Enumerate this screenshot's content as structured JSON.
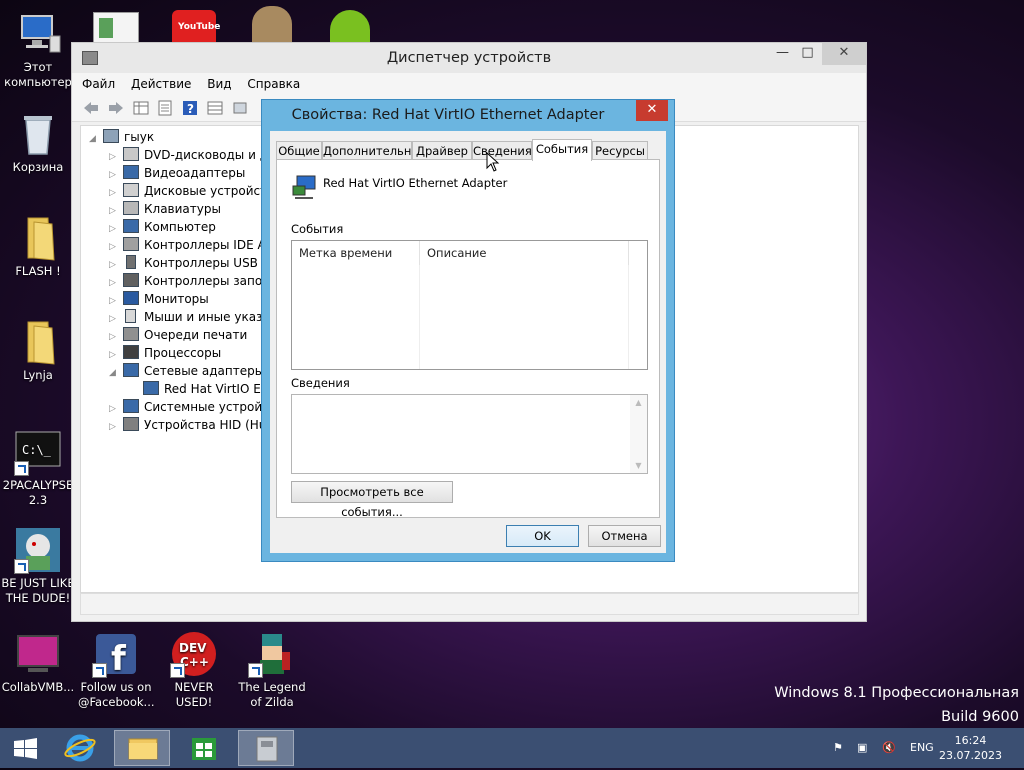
{
  "desktop_icons": [
    {
      "label": "Этот компьютер"
    },
    {
      "label": "Корзина"
    },
    {
      "label": "FLASH !"
    },
    {
      "label": "Lynja"
    },
    {
      "label": "2PACALYPSE 2.3"
    },
    {
      "label": "BE JUST LIKE THE DUDE!"
    },
    {
      "label": "CollabVMB..."
    },
    {
      "label": "Follow us on @Facebook..."
    },
    {
      "label": "NEVER USED!"
    },
    {
      "label": "The Legend of Zilda"
    }
  ],
  "device_manager": {
    "title": "Диспетчер устройств",
    "menu": [
      "Файл",
      "Действие",
      "Вид",
      "Справка"
    ],
    "tree": {
      "root": "гыук",
      "items": [
        "DVD-дисководы и дис",
        "Видеоадаптеры",
        "Дисковые устройства",
        "Клавиатуры",
        "Компьютер",
        "Контроллеры IDE ATA",
        "Контроллеры USB",
        "Контроллеры запоми",
        "Мониторы",
        "Мыши и иные указы",
        "Очереди печати",
        "Процессоры",
        "Сетевые адаптеры",
        "Red Hat VirtIO Ethe",
        "Системные устройств",
        "Устройства HID (Hum"
      ]
    }
  },
  "dialog": {
    "title": "Свойства: Red Hat VirtIO Ethernet Adapter",
    "tabs": [
      "Общие",
      "Дополнительно",
      "Драйвер",
      "Сведения",
      "События",
      "Ресурсы"
    ],
    "selected_tab": "События",
    "device_name": "Red Hat VirtIO Ethernet Adapter",
    "events_label": "События",
    "columns": [
      "Метка времени",
      "Описание"
    ],
    "details_label": "Сведения",
    "view_all_button": "Просмотреть все события...",
    "ok_button": "OK",
    "cancel_button": "Отмена"
  },
  "watermark": {
    "line1": "Windows 8.1 Профессиональная",
    "line2": "Build 9600"
  },
  "taskbar": {
    "language": "ENG",
    "time": "16:24",
    "date": "23.07.2023"
  },
  "colors": {
    "dialog_frame": "#6bb5e0",
    "close_red": "#c73b2f",
    "taskbar": "#3b4f72"
  }
}
